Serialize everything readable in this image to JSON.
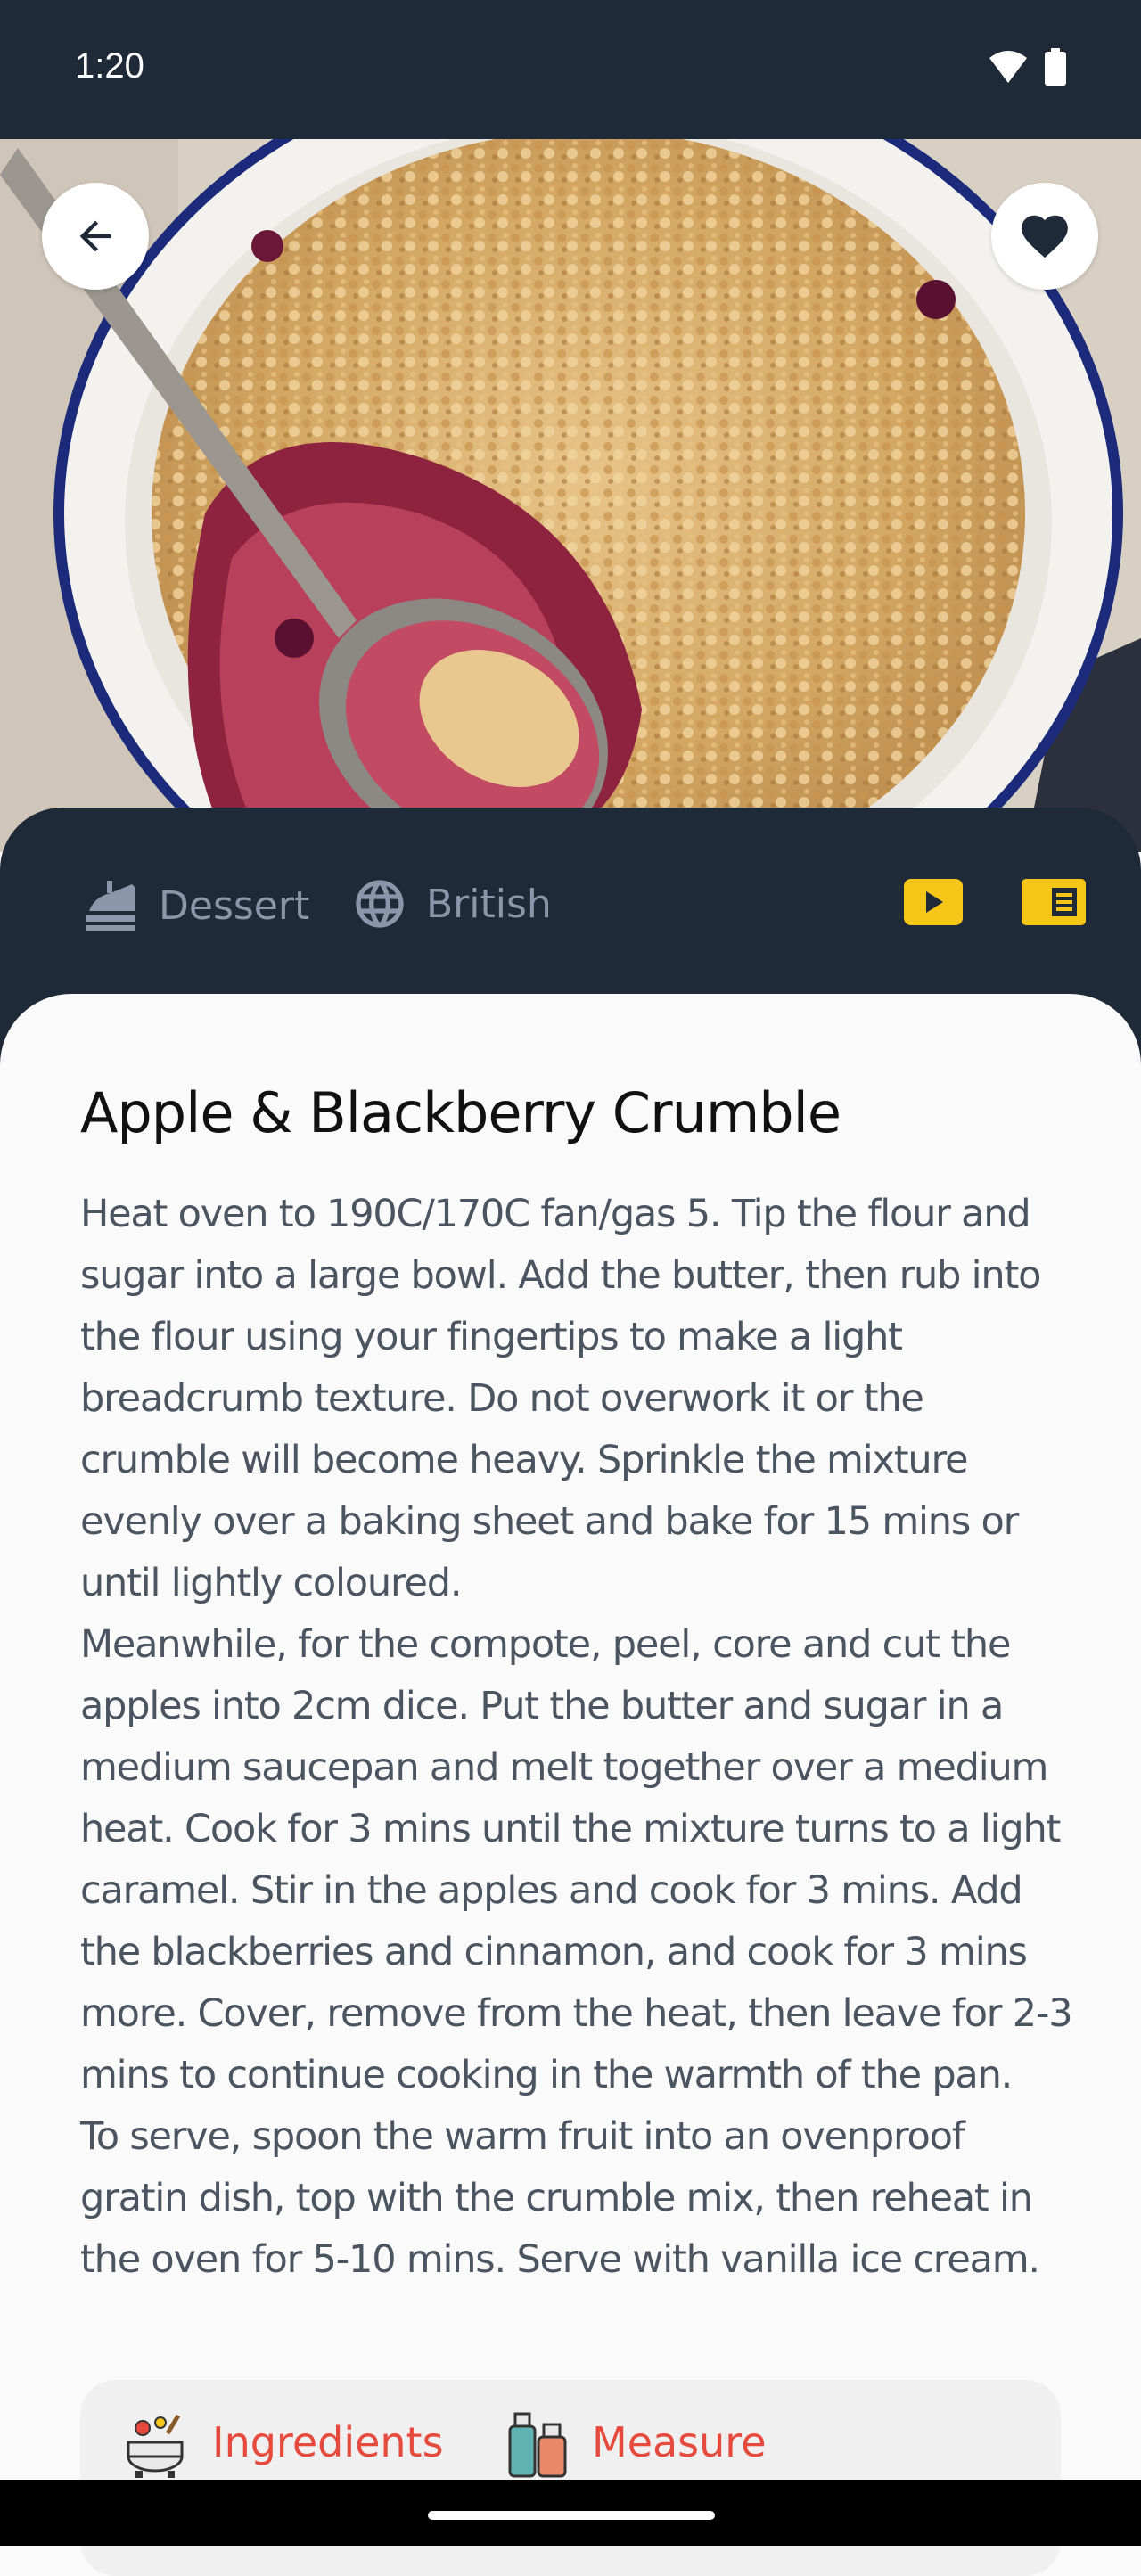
{
  "status_bar": {
    "time": "1:20"
  },
  "hero": {
    "image": "apple-blackberry-crumble-photo"
  },
  "info": {
    "category": "Dessert",
    "area": "British"
  },
  "recipe": {
    "title": "Apple & Blackberry Crumble",
    "instructions": [
      "Heat oven to 190C/170C fan/gas 5. Tip the flour and sugar into a large bowl. Add the butter, then rub into the flour using your fingertips to make a light breadcrumb texture. Do not overwork it or the crumble will become heavy. Sprinkle the mixture evenly over a baking sheet and bake for 15 mins or until lightly coloured.",
      "Meanwhile, for the compote, peel, core and cut the apples into 2cm dice. Put the butter and sugar in a medium saucepan and melt together over a medium heat. Cook for 3 mins until the mixture turns to a light caramel. Stir in the apples and cook for 3 mins. Add the blackberries and cinnamon, and cook for 3 mins more. Cover, remove from the heat, then leave for 2-3 mins to continue cooking in the warmth of the pan.",
      "To serve, spoon the warm fruit into an ovenproof gratin dish, top with the crumble mix, then reheat in the oven for 5-10 mins. Serve with vanilla ice cream."
    ]
  },
  "tabs": {
    "ingredients": "Ingredients",
    "measure": "Measure"
  },
  "colors": {
    "dark_bg": "#1f2a38",
    "accent_yellow": "#f5c518",
    "tab_red": "#e64a3c"
  }
}
